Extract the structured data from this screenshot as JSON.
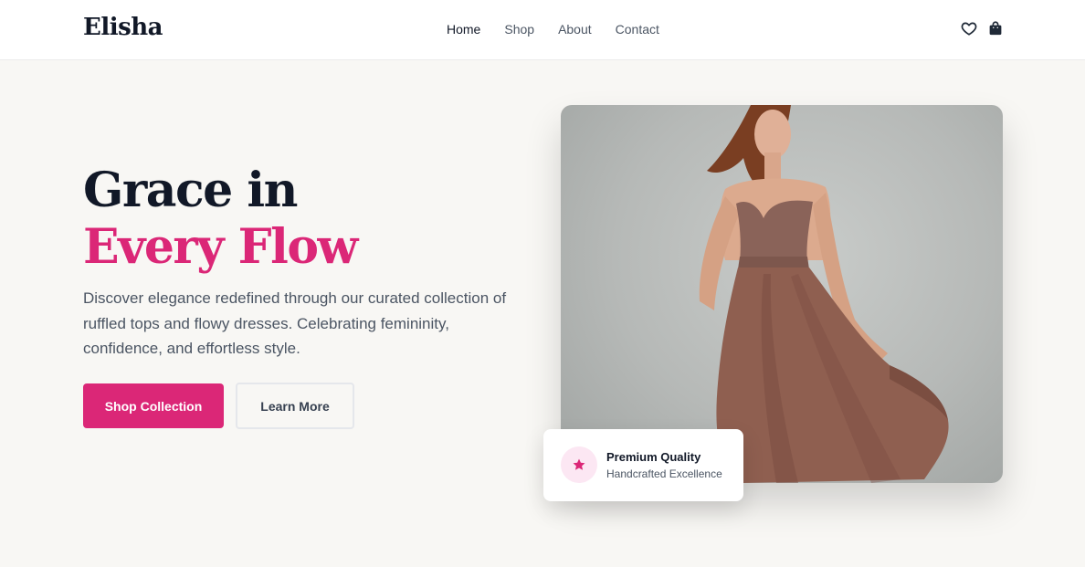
{
  "brand": {
    "logo": "Elisha",
    "accent": "#db2777"
  },
  "nav": {
    "items": [
      {
        "label": "Home",
        "active": true
      },
      {
        "label": "Shop"
      },
      {
        "label": "About"
      },
      {
        "label": "Contact"
      }
    ]
  },
  "header_icons": [
    "heart-icon",
    "shopping-bag-icon"
  ],
  "hero": {
    "title_line1": "Grace in",
    "title_line2": "Every Flow",
    "description": "Discover elegance redefined through our curated collection of ruffled tops and flowy dresses. Celebrating femininity, confidence, and effortless style.",
    "primary_button": "Shop Collection",
    "secondary_button": "Learn More",
    "image_alt": "Model in a flowing mauve strapless gown"
  },
  "badge": {
    "icon": "star-icon",
    "title": "Premium Quality",
    "subtitle": "Handcrafted Excellence"
  }
}
